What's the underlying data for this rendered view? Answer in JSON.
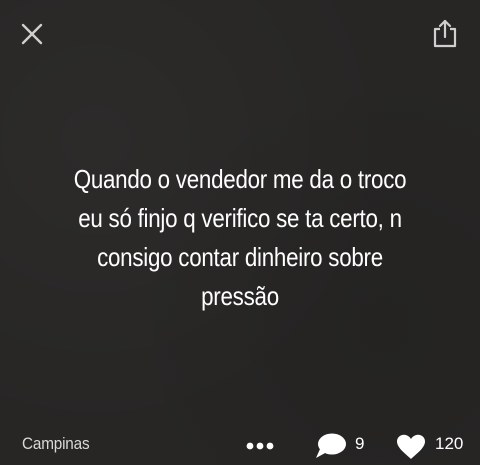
{
  "post": {
    "lines": [
      "Quando o vendedor me da o troco",
      "eu só finjo q verifico se ta certo, n",
      "consigo contar dinheiro sobre",
      "pressão"
    ]
  },
  "footer": {
    "location": "Campinas",
    "replies": "9",
    "likes": "120"
  },
  "icons": {
    "close": "close-icon",
    "share": "share-icon",
    "more": "more-options-icon",
    "reply": "speech-bubble-icon",
    "like": "heart-icon"
  },
  "colors": {
    "background": "#272625",
    "text": "#ffffff",
    "icon": "#cfcfcf"
  }
}
